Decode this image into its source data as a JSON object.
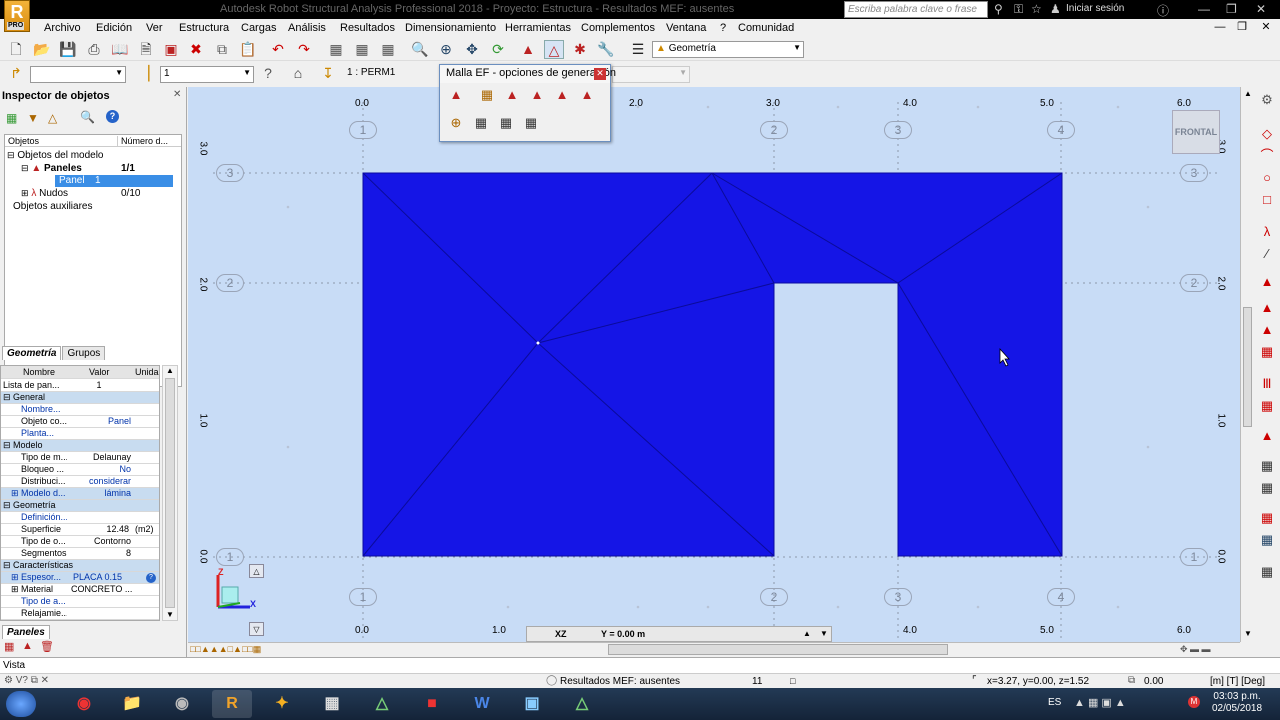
{
  "titlebar": {
    "title": "Autodesk Robot Structural Analysis Professional 2018 - Proyecto: Estructura - Resultados MEF: ausentes",
    "search_placeholder": "Escriba palabra clave o frase",
    "signin": "Iniciar sesión",
    "logo": "R",
    "logo_sub": "PRO"
  },
  "menu": [
    "Archivo",
    "Edición",
    "Ver",
    "Estructura",
    "Cargas",
    "Análisis",
    "Resultados",
    "Dimensionamiento",
    "Herramientas",
    "Complementos",
    "Ventana",
    "?",
    "Comunidad"
  ],
  "toolbar": {
    "layout_combo": "Geometría",
    "section_combo": "1",
    "case_combo": "1 : PERM1"
  },
  "inspector": {
    "title": "Inspector de objetos",
    "tree_headers": [
      "Objetos",
      "Número d..."
    ],
    "tree": [
      {
        "label": "Objetos del modelo",
        "value": ""
      },
      {
        "label": "Paneles",
        "value": "1/1"
      },
      {
        "label": "Panel",
        "value": "1"
      },
      {
        "label": "Nudos",
        "value": "0/10"
      },
      {
        "label": "Objetos auxiliares",
        "value": ""
      }
    ],
    "tabs": [
      "Geometría",
      "Grupos"
    ],
    "props_headers": [
      "Nombre",
      "Valor",
      "Unida"
    ],
    "props": [
      {
        "name": "Lista de pan...",
        "value": "1",
        "unit": "",
        "type": "plain"
      },
      {
        "name": "General",
        "value": "",
        "unit": "",
        "type": "section"
      },
      {
        "name": "Nombre...",
        "value": "",
        "unit": "",
        "type": "link"
      },
      {
        "name": "Objeto co...",
        "value": "Panel",
        "unit": "",
        "type": "plain"
      },
      {
        "name": "Planta...",
        "value": "",
        "unit": "",
        "type": "link"
      },
      {
        "name": "Modelo",
        "value": "",
        "unit": "",
        "type": "section"
      },
      {
        "name": "Tipo de m...",
        "value": "Delaunay",
        "unit": "",
        "type": "plain"
      },
      {
        "name": "Bloqueo ...",
        "value": "No",
        "unit": "",
        "type": "plain"
      },
      {
        "name": "Distribuci...",
        "value": "considerar",
        "unit": "",
        "type": "plain"
      },
      {
        "name": "Modelo d...",
        "value": "lámina",
        "unit": "",
        "type": "hl"
      },
      {
        "name": "Geometría",
        "value": "",
        "unit": "",
        "type": "section"
      },
      {
        "name": "Definición...",
        "value": "",
        "unit": "",
        "type": "link"
      },
      {
        "name": "Superficie",
        "value": "12.48",
        "unit": "(m2)",
        "type": "plain"
      },
      {
        "name": "Tipo de o...",
        "value": "Contorno",
        "unit": "",
        "type": "plain"
      },
      {
        "name": "Segmentos",
        "value": "8",
        "unit": "",
        "type": "plain"
      },
      {
        "name": "Características",
        "value": "",
        "unit": "",
        "type": "section"
      },
      {
        "name": "Espesor...",
        "value": "PLACA 0.15",
        "unit": "",
        "type": "hl"
      },
      {
        "name": "Material",
        "value": "CONCRETO ...",
        "unit": "",
        "type": "plain"
      },
      {
        "name": "Tipo de a...",
        "value": "",
        "unit": "",
        "type": "link"
      },
      {
        "name": "Relajamie...",
        "value": "",
        "unit": "",
        "type": "plain"
      }
    ],
    "bottom_tab": "Paneles"
  },
  "popup": {
    "title": "Malla EF - opciones de generación"
  },
  "viewport": {
    "view_label": "FRONTAL",
    "x_ticks": [
      "0.0",
      "1.0",
      "2.0",
      "3.0",
      "4.0",
      "5.0",
      "6.0"
    ],
    "y_ticks": [
      "0.0",
      "1.0",
      "2.0",
      "3.0"
    ],
    "grid_x_labels": [
      "1",
      "2",
      "3",
      "4"
    ],
    "grid_y_labels": [
      "1",
      "2",
      "3"
    ],
    "plane": "XZ",
    "coord": "Y = 0.00 m",
    "axis_z": "Z",
    "axis_x": "X",
    "panel_color": "#1515e6"
  },
  "vista_label": "Vista",
  "status": {
    "results": "Resultados MEF: ausentes",
    "count": "11",
    "coords": "x=3.27, y=0.00, z=1.52",
    "value": "0.00",
    "units": "[m] [T] [Deg]"
  },
  "taskbar": {
    "lang": "ES",
    "time": "03:03 p.m.",
    "date": "02/05/2018"
  }
}
